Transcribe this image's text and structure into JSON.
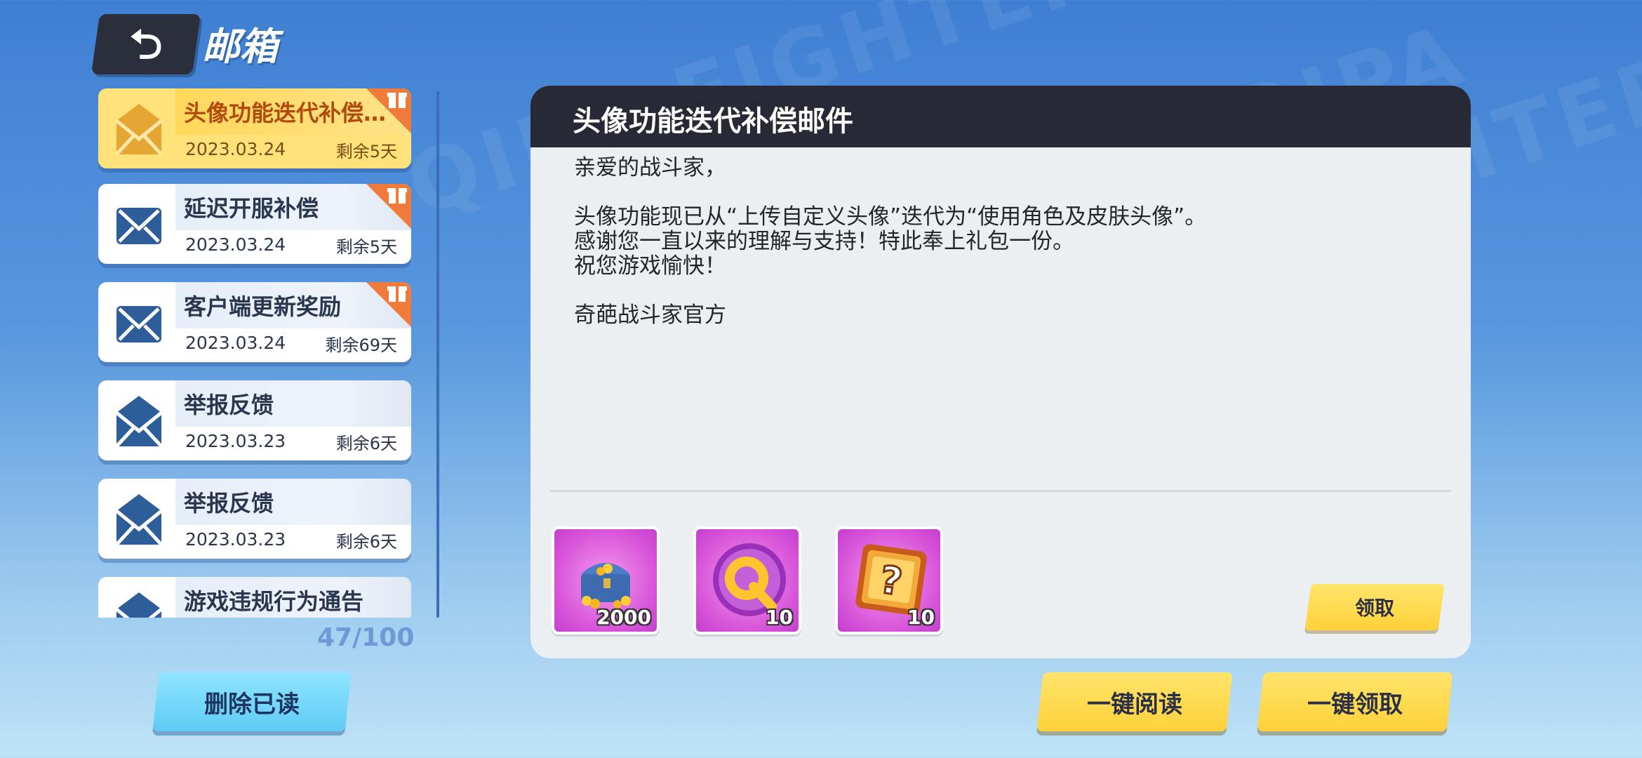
{
  "header": {
    "back_icon": "back-arrow-icon",
    "title": "邮箱"
  },
  "watermark": "QIPA FIGHTER",
  "mail_list": [
    {
      "subject": "头像功能迭代补偿...",
      "date": "2023.03.24",
      "remaining": "剩余5天",
      "has_gift": true,
      "selected": true
    },
    {
      "subject": "延迟开服补偿",
      "date": "2023.03.24",
      "remaining": "剩余5天",
      "has_gift": true,
      "selected": false
    },
    {
      "subject": "客户端更新奖励",
      "date": "2023.03.24",
      "remaining": "剩余69天",
      "has_gift": true,
      "selected": false
    },
    {
      "subject": "举报反馈",
      "date": "2023.03.23",
      "remaining": "剩余6天",
      "has_gift": false,
      "selected": false
    },
    {
      "subject": "举报反馈",
      "date": "2023.03.23",
      "remaining": "剩余6天",
      "has_gift": false,
      "selected": false
    },
    {
      "subject": "游戏违规行为通告",
      "date": "",
      "remaining": "",
      "has_gift": false,
      "selected": false
    }
  ],
  "mail_count": "47/100",
  "delete_read_label": "删除已读",
  "detail": {
    "title": "头像功能迭代补偿邮件",
    "greeting": "亲爱的战斗家，",
    "line1": "头像功能现已从“上传自定义头像”迭代为“使用角色及皮肤头像”。",
    "line2": "感谢您一直以来的理解与支持！特此奉上礼包一份。",
    "line3": "祝您游戏愉快！",
    "signature": "奇葩战斗家官方",
    "rewards": [
      {
        "icon": "treasure-chest-icon",
        "qty": "2000"
      },
      {
        "icon": "q-coin-icon",
        "qty": "10"
      },
      {
        "icon": "mystery-box-icon",
        "qty": "10"
      }
    ],
    "claim_label": "领取"
  },
  "read_all_label": "一键阅读",
  "claim_all_label": "一键领取",
  "colors": {
    "selected_bg": "#ffe27a",
    "envelope_blue": "#2d5e9a",
    "envelope_gold": "#e5a634",
    "gift_tag": "#f07a3a",
    "header_dark": "#272a36",
    "button_yellow": "#ffd13a",
    "button_cyan": "#5fcbf5"
  }
}
